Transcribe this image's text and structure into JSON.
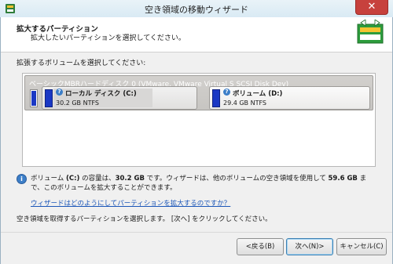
{
  "window": {
    "title": "空き領域の移動ウィザード",
    "close_symbol": "✕",
    "app_icon": "partition-wizard-icon"
  },
  "header": {
    "title": "拡大するパーティション",
    "subtitle": "拡大したいパーティションを選択してください。",
    "icon": "resize-arrows-icon"
  },
  "content": {
    "prompt": "拡張するボリュームを選択してください:",
    "disk": {
      "label": "ベーシックMBRハードディスク 0 (VMware, VMware Virtual S SCSI Disk Dev)",
      "partitions": [
        {
          "name": "ローカル ディスク (C:)",
          "size": "30.2 GB NTFS",
          "selected": true
        },
        {
          "name": "ボリューム (D:)",
          "size": "29.4 GB NTFS",
          "selected": false
        }
      ]
    },
    "info": {
      "part1": "ボリューム ",
      "drive": "(C:)",
      "part2": " の容量は、",
      "capacity": "30.2 GB",
      "part3": " です。ウィザードは、他のボリュームの空き領域を使用して ",
      "max": "59.6 GB",
      "part4": " まで、このボリュームを拡大することができます。"
    },
    "help_link": "ウィザードはどのようにしてパーティションを拡大するのですか？",
    "instruction": "空き領域を取得するパーティションを選択します。 [次へ] をクリックしてください。"
  },
  "footer": {
    "back": "<戻る(B)",
    "next": "次へ(N)>",
    "cancel": "キャンセル(C)"
  },
  "colors": {
    "partition_bar": "#1a38c4",
    "close_button": "#c7413d",
    "link": "#1b56b8"
  }
}
